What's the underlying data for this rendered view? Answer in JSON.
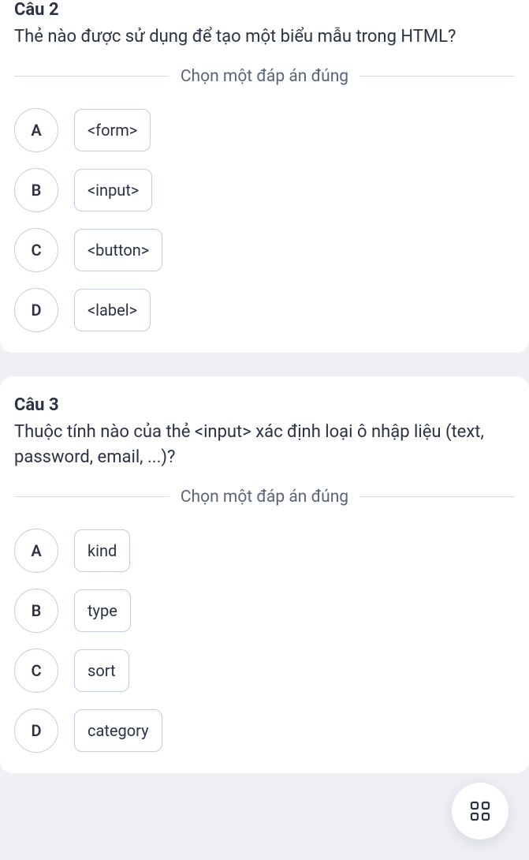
{
  "questions": [
    {
      "number_label": "Câu 2",
      "text": "Thẻ nào được sử dụng để tạo một biểu mẫu trong HTML?",
      "instruction": "Chọn một đáp án đúng",
      "options": [
        {
          "letter": "A",
          "text": "<form>"
        },
        {
          "letter": "B",
          "text": "<input>"
        },
        {
          "letter": "C",
          "text": "<button>"
        },
        {
          "letter": "D",
          "text": "<label>"
        }
      ]
    },
    {
      "number_label": "Câu 3",
      "text": "Thuộc tính nào của thẻ <input> xác định loại ô nhập liệu (text, password, email, ...)?",
      "instruction": "Chọn một đáp án đúng",
      "options": [
        {
          "letter": "A",
          "text": "kind"
        },
        {
          "letter": "B",
          "text": "type"
        },
        {
          "letter": "C",
          "text": "sort"
        },
        {
          "letter": "D",
          "text": "category"
        }
      ]
    }
  ]
}
